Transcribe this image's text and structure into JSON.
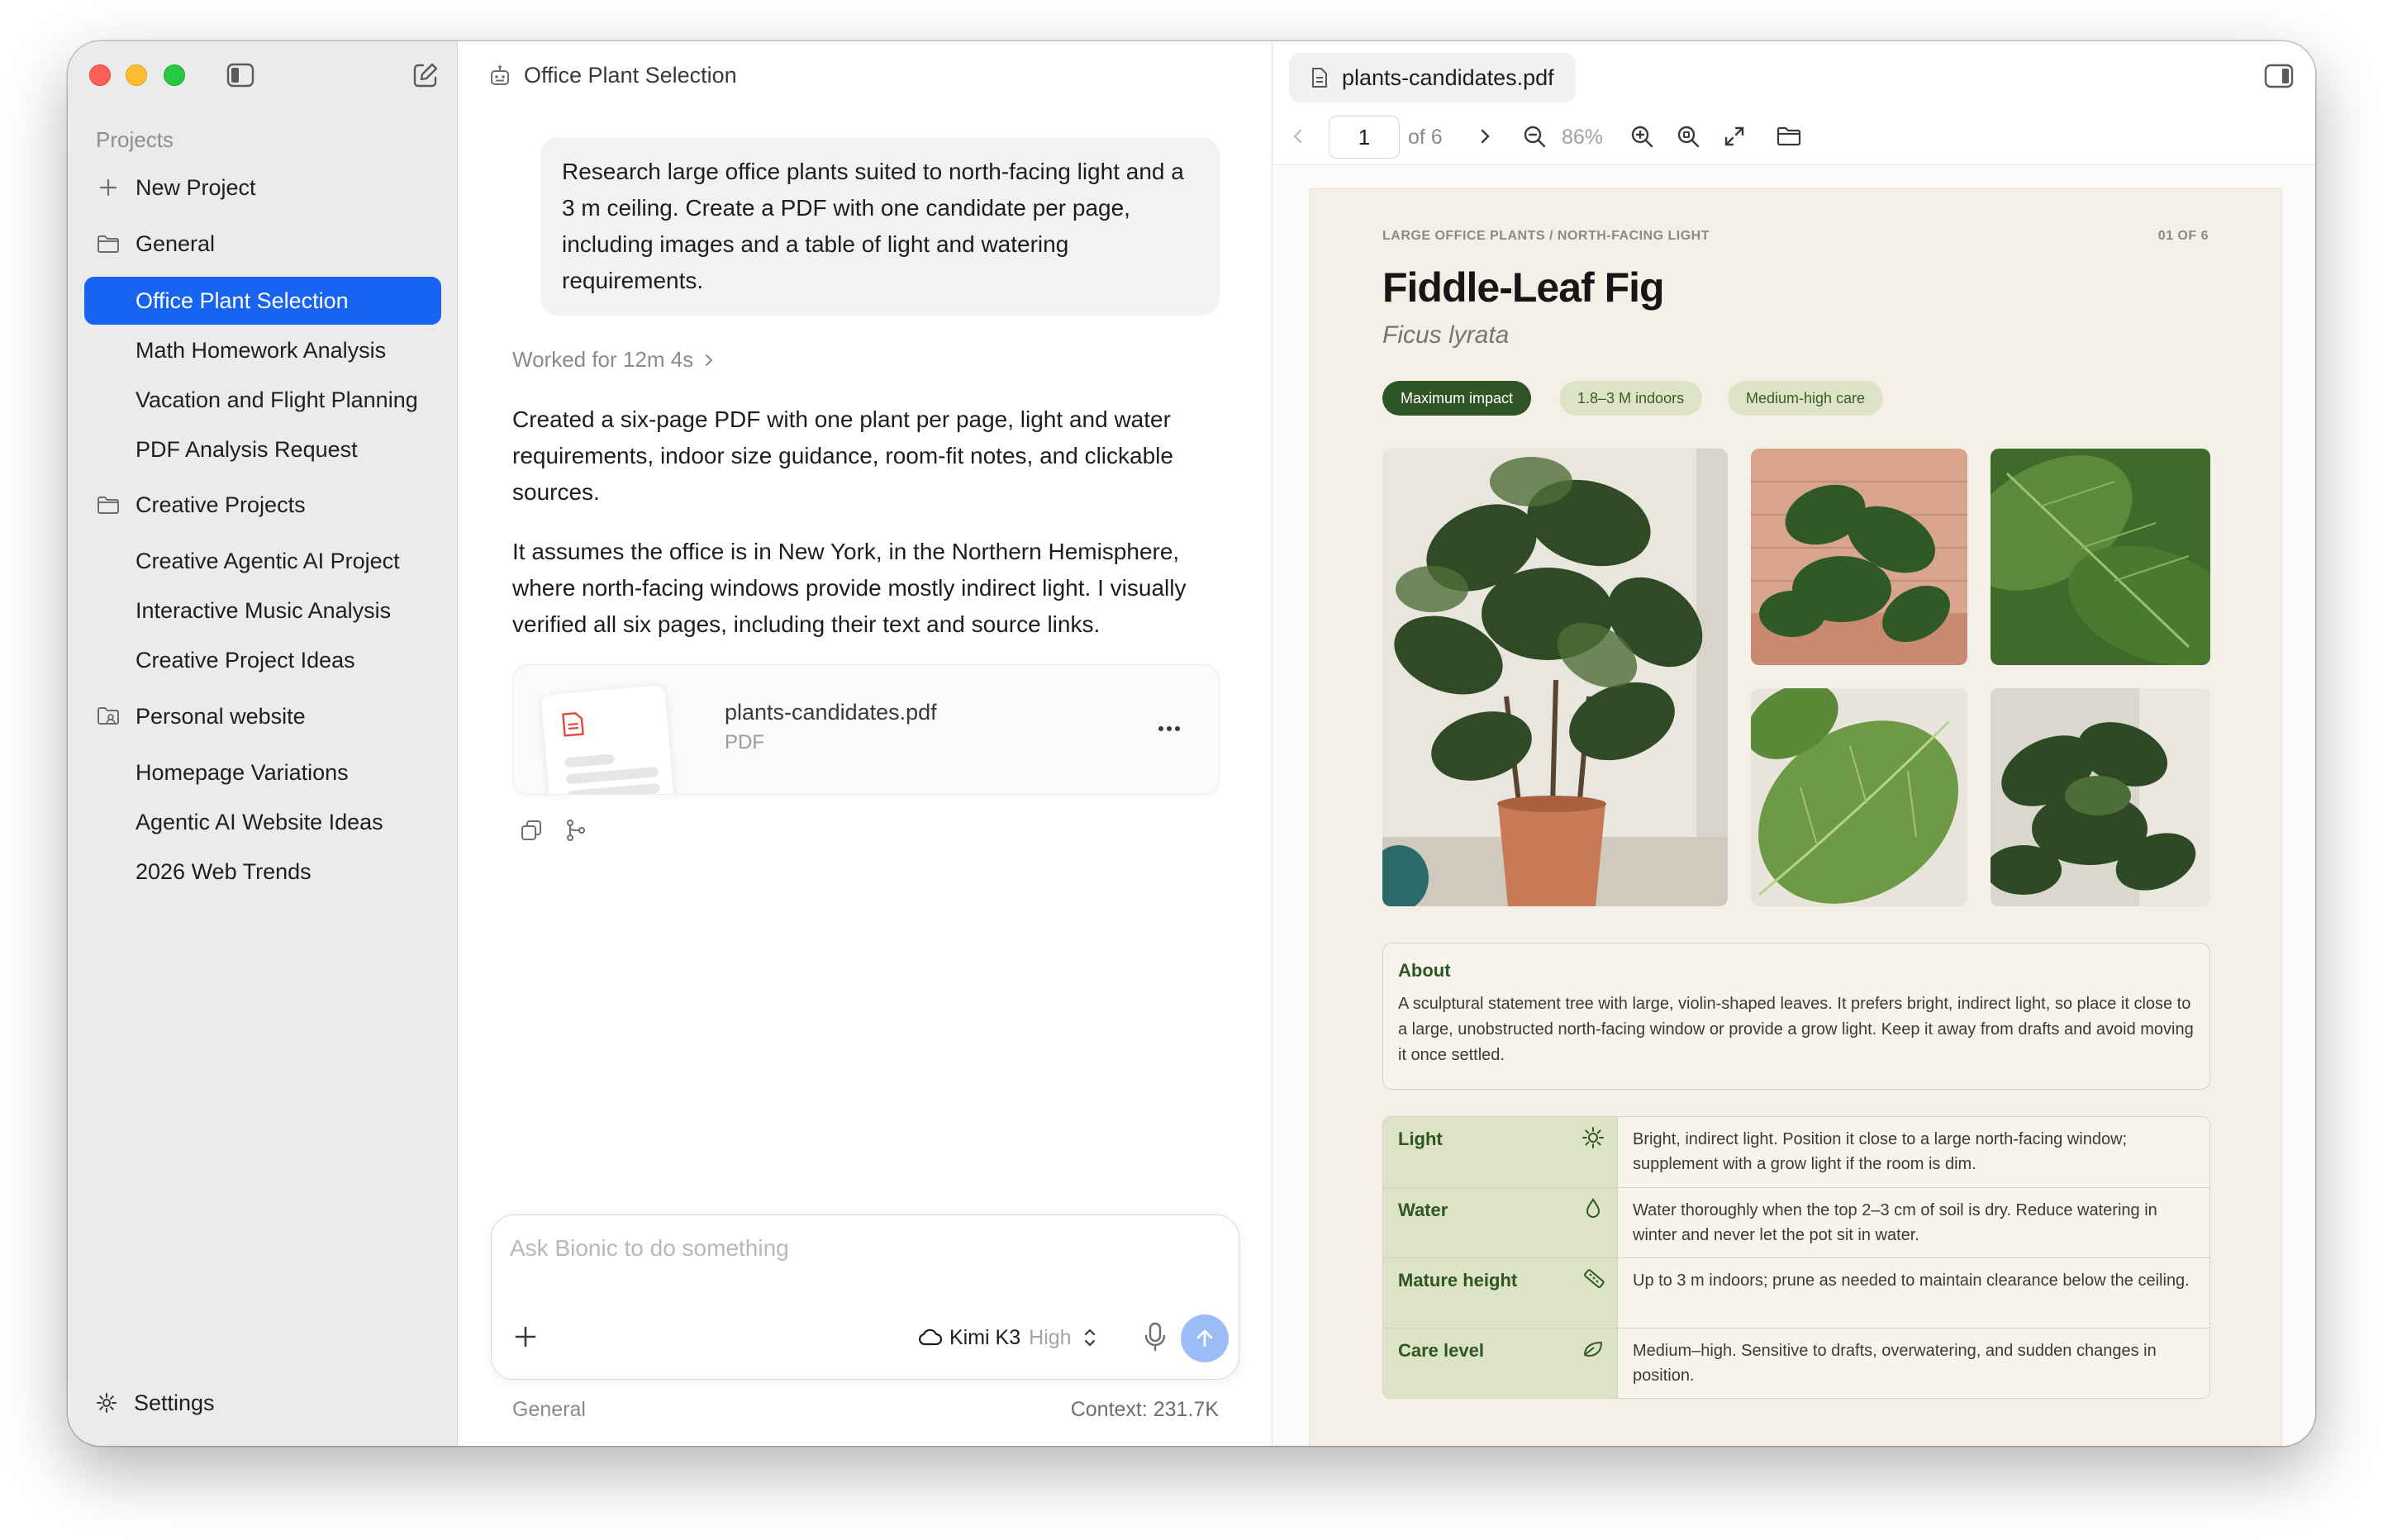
{
  "sidebar": {
    "projects_label": "Projects",
    "new_project": "New Project",
    "settings": "Settings",
    "groups": [
      {
        "name": "General",
        "items": [
          "Office Plant Selection",
          "Math Homework Analysis",
          "Vacation and Flight Planning",
          "PDF Analysis Request"
        ]
      },
      {
        "name": "Creative Projects",
        "items": [
          "Creative Agentic AI Project",
          "Interactive Music Analysis",
          "Creative Project Ideas"
        ]
      },
      {
        "name": "Personal website",
        "items": [
          "Homepage Variations",
          "Agentic AI Website Ideas",
          "2026 Web Trends"
        ]
      }
    ],
    "active_item": "Office Plant Selection"
  },
  "chat": {
    "title": "Office Plant Selection",
    "user_message": "Research large office plants suited to north-facing light and a 3 m ceiling. Create a PDF with one candidate per page, including images and a table of light and watering requirements.",
    "worked_for": "Worked for 12m 4s",
    "response_p1": "Created a six-page PDF with one plant per page, light and water requirements, indoor size guidance, room-fit notes, and clickable sources.",
    "response_p2": "It assumes the office is in New York, in the Northern Hemisphere, where north-facing windows provide mostly indirect light. I visually verified all six pages, including their text and source links.",
    "attachment": {
      "name": "plants-candidates.pdf",
      "type": "PDF"
    },
    "composer": {
      "placeholder": "Ask Bionic to do something",
      "model": "Kimi K3",
      "effort": "High"
    },
    "footer_project": "General",
    "footer_context": "Context: 231.7K"
  },
  "pdf_viewer": {
    "tab_title": "plants-candidates.pdf",
    "current_page": "1",
    "page_of": "of 6",
    "zoom": "86%",
    "page": {
      "eyebrow": "LARGE OFFICE PLANTS / NORTH-FACING LIGHT",
      "page_label": "01 OF 6",
      "title": "Fiddle-Leaf Fig",
      "latin": "Ficus lyrata",
      "tags": [
        "Maximum impact",
        "1.8–3 M indoors",
        "Medium-high care"
      ],
      "about_heading": "About",
      "about_text": "A sculptural statement tree with large, violin-shaped leaves. It prefers bright, indirect light, so place it close to a large, unobstructed north-facing window or provide a grow light. Keep it away from drafts and avoid moving it once settled.",
      "care": [
        {
          "label": "Light",
          "icon": "sun-icon",
          "text": "Bright, indirect light. Position it close to a large north-facing window; supplement with a grow light if the room is dim."
        },
        {
          "label": "Water",
          "icon": "water-drop-icon",
          "text": "Water thoroughly when the top 2–3 cm of soil is dry. Reduce watering in winter and never let the pot sit in water."
        },
        {
          "label": "Mature height",
          "icon": "ruler-icon",
          "text": "Up to 3 m indoors; prune as needed to maintain clearance below the ceiling."
        },
        {
          "label": "Care level",
          "icon": "leaf-icon",
          "text": "Medium–high. Sensitive to drafts, overwatering, and sudden changes in position."
        }
      ]
    }
  },
  "colors": {
    "accent": "#1864f2",
    "pdf_green": "#2f5527",
    "pdf_tag_light": "#dde4c5",
    "pdf_paper": "#f4f0e8"
  }
}
